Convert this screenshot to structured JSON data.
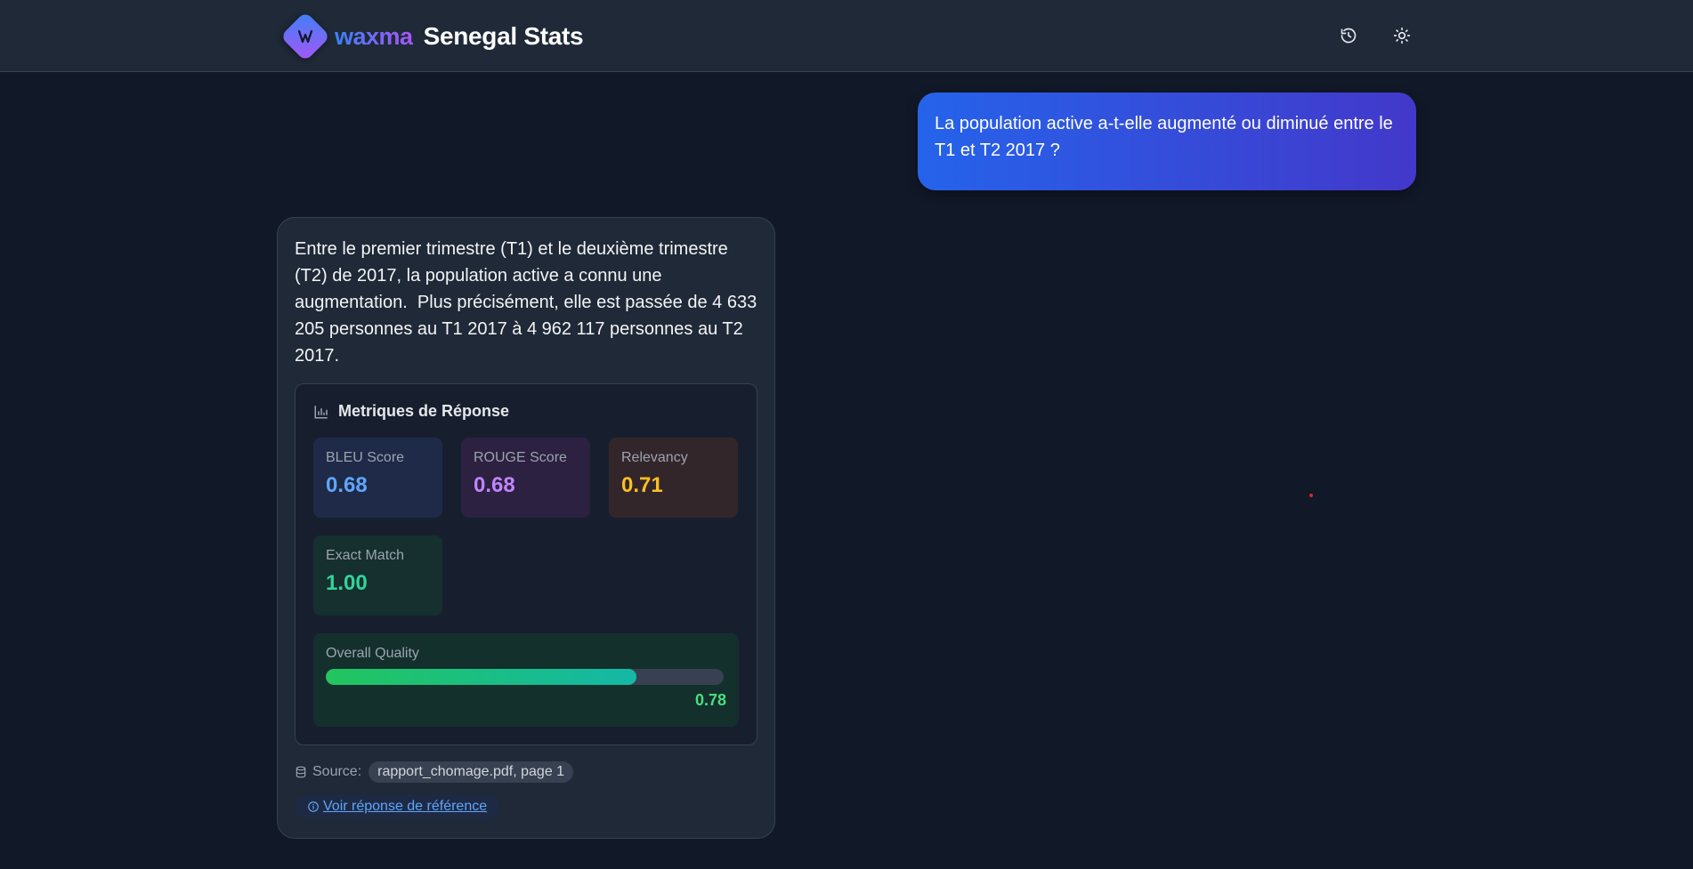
{
  "header": {
    "brand": "waxma",
    "title": "Senegal Stats",
    "history_icon": "history-icon",
    "theme_icon": "sun-icon"
  },
  "user_message": {
    "text": "La population active a-t-elle augmenté ou diminué entre le T1 et T2 2017 ?"
  },
  "bot_message": {
    "text": "Entre le premier trimestre (T1) et le deuxième trimestre (T2) de 2017, la population active a connu une augmentation.  Plus précisément, elle est passée de 4 633 205 personnes au T1 2017 à 4 962 117 personnes au T2 2017.",
    "metrics": {
      "title": "Metriques de Réponse",
      "title_icon": "bar-chart-icon",
      "items": [
        {
          "label": "BLEU Score",
          "value": "0.68",
          "color": "#60a5fa",
          "bg": "#1e2a48"
        },
        {
          "label": "ROUGE Score",
          "value": "0.68",
          "color": "#c084fc",
          "bg": "#2c2140"
        },
        {
          "label": "Relevancy",
          "value": "0.71",
          "color": "#fbbf24",
          "bg": "#33262a"
        },
        {
          "label": "Exact Match",
          "value": "1.00",
          "color": "#34d399",
          "bg": "#15302e"
        }
      ],
      "overall": {
        "label": "Overall Quality",
        "value": "0.78",
        "fraction": 0.78
      }
    },
    "source": {
      "label": "Source:",
      "icon": "database-icon",
      "value": "rapport_chomage.pdf, page 1"
    },
    "reference_link": {
      "icon": "info-icon",
      "label": "Voir réponse de référence"
    }
  }
}
